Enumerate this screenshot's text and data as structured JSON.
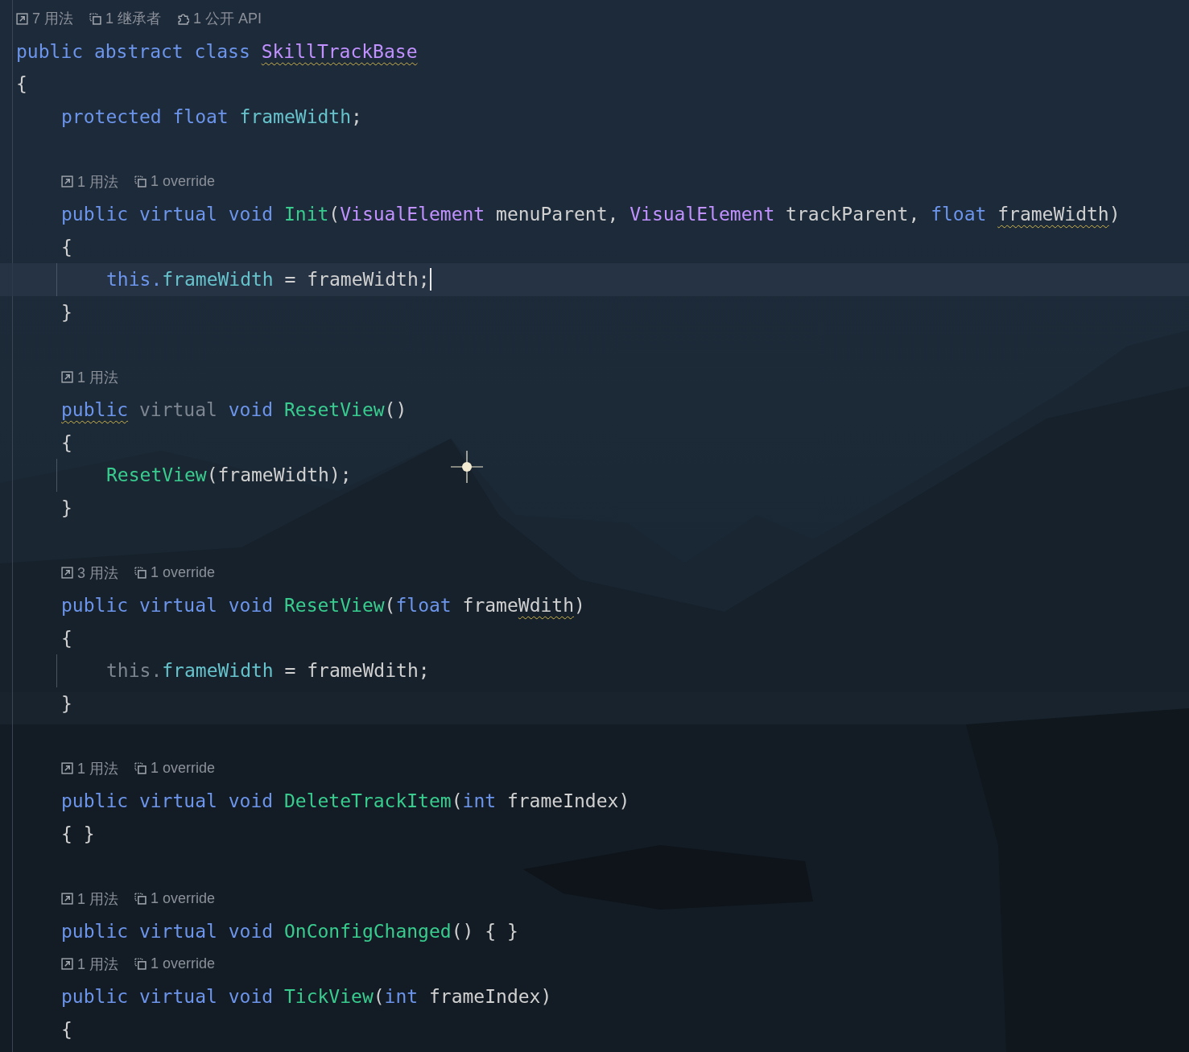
{
  "editor": {
    "lines": [
      {
        "kind": "hint",
        "hints": [
          {
            "kind": "usages",
            "text": "7 用法"
          },
          {
            "kind": "inheritors",
            "text": "1 继承者"
          },
          {
            "kind": "api",
            "text": "1 公开 API"
          }
        ]
      },
      {
        "kind": "code",
        "tokens": [
          {
            "color": "#6c95eb",
            "text": "public abstract class "
          },
          {
            "color": "#c191ff",
            "text": "SkillTrackBase",
            "underlined": true
          }
        ]
      },
      {
        "kind": "code",
        "tokens": [
          {
            "color": "#d0d0d0",
            "text": "{"
          }
        ],
        "children": [
          {
            "kind": "code",
            "tokens": [
              {
                "color": "#6c95eb",
                "text": "protected float "
              },
              {
                "color": "#66c3cc",
                "text": "frameWidth"
              },
              {
                "color": "#d0d0d0",
                "text": ";"
              }
            ]
          },
          {
            "kind": "blank"
          },
          {
            "kind": "hint",
            "hints": [
              {
                "kind": "usages",
                "text": "1 用法"
              },
              {
                "kind": "overrides",
                "text": "1 override"
              }
            ]
          },
          {
            "kind": "code",
            "tokens": [
              {
                "color": "#6c95eb",
                "text": "public virtual void "
              },
              {
                "color": "#39cc8f",
                "text": "Init"
              },
              {
                "color": "#d0d0d0",
                "text": "("
              },
              {
                "color": "#c191ff",
                "text": "VisualElement"
              },
              {
                "color": "#d0d0d0",
                "text": " menuParent, "
              },
              {
                "color": "#c191ff",
                "text": "VisualElement"
              },
              {
                "color": "#d0d0d0",
                "text": " trackParent, "
              },
              {
                "color": "#6c95eb",
                "text": "float "
              },
              {
                "color": "#d0d0d0",
                "text": "frameWidth",
                "underlined": true
              },
              {
                "color": "#d0d0d0",
                "text": ")"
              }
            ]
          },
          {
            "kind": "code",
            "tokens": [
              {
                "color": "#d0d0d0",
                "text": "{"
              }
            ],
            "children": [
              {
                "kind": "code",
                "current": true,
                "caret": true,
                "tokens": [
                  {
                    "color": "#6c95eb",
                    "text": "this."
                  },
                  {
                    "color": "#66c3cc",
                    "text": "frameWidth"
                  },
                  {
                    "color": "#d0d0d0",
                    "text": " = frameWidth;"
                  }
                ]
              }
            ]
          },
          {
            "kind": "code",
            "tokens": [
              {
                "color": "#d0d0d0",
                "text": "}"
              }
            ]
          },
          {
            "kind": "blank"
          },
          {
            "kind": "hint",
            "hints": [
              {
                "kind": "usages",
                "text": "1 用法"
              }
            ]
          },
          {
            "kind": "code",
            "tokens": [
              {
                "color": "#6c95eb",
                "text": "public",
                "underlined": true
              },
              {
                "color": "#7d8590",
                "text": " virtual"
              },
              {
                "color": "#6c95eb",
                "text": " void "
              },
              {
                "color": "#39cc8f",
                "text": "ResetView"
              },
              {
                "color": "#d0d0d0",
                "text": "()"
              }
            ]
          },
          {
            "kind": "code",
            "tokens": [
              {
                "color": "#d0d0d0",
                "text": "{"
              }
            ],
            "children": [
              {
                "kind": "code",
                "tokens": [
                  {
                    "color": "#39cc8f",
                    "text": "ResetView"
                  },
                  {
                    "color": "#d0d0d0",
                    "text": "(frameWidth);"
                  }
                ]
              }
            ]
          },
          {
            "kind": "code",
            "tokens": [
              {
                "color": "#d0d0d0",
                "text": "}"
              }
            ]
          },
          {
            "kind": "blank"
          },
          {
            "kind": "hint",
            "hints": [
              {
                "kind": "usages",
                "text": "3 用法"
              },
              {
                "kind": "overrides",
                "text": "1 override"
              }
            ]
          },
          {
            "kind": "code",
            "tokens": [
              {
                "color": "#6c95eb",
                "text": "public virtual void "
              },
              {
                "color": "#39cc8f",
                "text": "ResetView"
              },
              {
                "color": "#d0d0d0",
                "text": "("
              },
              {
                "color": "#6c95eb",
                "text": "float "
              },
              {
                "color": "#d0d0d0",
                "text": "frame"
              },
              {
                "color": "#d0d0d0",
                "text": "Wdith",
                "underlined": true
              },
              {
                "color": "#d0d0d0",
                "text": ")"
              }
            ]
          },
          {
            "kind": "code",
            "tokens": [
              {
                "color": "#d0d0d0",
                "text": "{"
              }
            ],
            "children": [
              {
                "kind": "code",
                "tokens": [
                  {
                    "color": "#7d8590",
                    "text": "this."
                  },
                  {
                    "color": "#66c3cc",
                    "text": "frameWidth"
                  },
                  {
                    "color": "#d0d0d0",
                    "text": " = frameWdith;"
                  }
                ]
              }
            ]
          },
          {
            "kind": "code",
            "tokens": [
              {
                "color": "#d0d0d0",
                "text": "}"
              }
            ]
          },
          {
            "kind": "blank"
          },
          {
            "kind": "hint",
            "hints": [
              {
                "kind": "usages",
                "text": "1 用法"
              },
              {
                "kind": "overrides",
                "text": "1 override"
              }
            ]
          },
          {
            "kind": "code",
            "tokens": [
              {
                "color": "#6c95eb",
                "text": "public virtual void "
              },
              {
                "color": "#39cc8f",
                "text": "DeleteTrackItem"
              },
              {
                "color": "#d0d0d0",
                "text": "("
              },
              {
                "color": "#6c95eb",
                "text": "int "
              },
              {
                "color": "#d0d0d0",
                "text": "frameIndex)"
              }
            ]
          },
          {
            "kind": "code",
            "tokens": [
              {
                "color": "#d0d0d0",
                "text": "{ }"
              }
            ]
          },
          {
            "kind": "blank"
          },
          {
            "kind": "hint",
            "hints": [
              {
                "kind": "usages",
                "text": "1 用法"
              },
              {
                "kind": "overrides",
                "text": "1 override"
              }
            ]
          },
          {
            "kind": "code",
            "tokens": [
              {
                "color": "#6c95eb",
                "text": "public virtual void "
              },
              {
                "color": "#39cc8f",
                "text": "OnConfigChanged"
              },
              {
                "color": "#d0d0d0",
                "text": "() { }"
              }
            ]
          },
          {
            "kind": "hint",
            "hints": [
              {
                "kind": "usages",
                "text": "1 用法"
              },
              {
                "kind": "overrides",
                "text": "1 override"
              }
            ]
          },
          {
            "kind": "code",
            "tokens": [
              {
                "color": "#6c95eb",
                "text": "public virtual void "
              },
              {
                "color": "#39cc8f",
                "text": "TickView"
              },
              {
                "color": "#d0d0d0",
                "text": "("
              },
              {
                "color": "#6c95eb",
                "text": "int "
              },
              {
                "color": "#d0d0d0",
                "text": "frameIndex)"
              }
            ]
          },
          {
            "kind": "code",
            "tokens": [
              {
                "color": "#d0d0d0",
                "text": "{"
              }
            ]
          }
        ]
      }
    ]
  }
}
